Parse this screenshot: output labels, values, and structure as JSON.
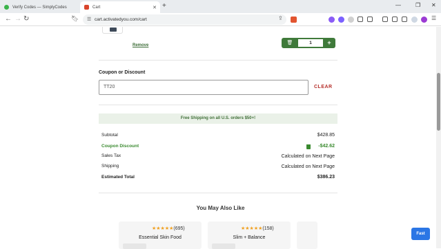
{
  "browser": {
    "tabs": [
      {
        "title": "Verify Codes — SimplyCodes",
        "active": false,
        "favicon_color": "#3bb34a"
      },
      {
        "title": "Cart",
        "active": true,
        "favicon_color": "#d9452c"
      }
    ],
    "new_tab_icon": "plus-icon",
    "url": "cart.activatedyou.com/cart"
  },
  "cart_item": {
    "remove_label": "Remove",
    "quantity": "1"
  },
  "coupon": {
    "title": "Coupon or Discount",
    "value": "TT20",
    "clear_label": "CLEAR"
  },
  "shipping_banner": "Free Shipping on all U.S. orders $50+!",
  "summary": {
    "subtotal_label": "Subtotal",
    "subtotal_value": "$428.85",
    "discount_label": "Coupon Discount",
    "discount_value": "-$42.62",
    "tax_label": "Sales Tax",
    "tax_value": "Calculated on Next Page",
    "shipping_label": "Shipping",
    "shipping_value": "Calculated on Next Page",
    "total_label": "Estimated Total",
    "total_value": "$386.23"
  },
  "also_like": {
    "title": "You May Also Like",
    "products": [
      {
        "stars": "★★★★★",
        "count": "(695)",
        "name": "Essential Skin Food"
      },
      {
        "stars": "★★★★★",
        "count": "(158)",
        "name": "Slim + Balance"
      }
    ]
  },
  "fast_button": "Fast",
  "colors": {
    "brand_green": "#3f7a3a",
    "discount_green": "#3a8a2f",
    "clear_red": "#b6302b",
    "fast_blue": "#2b76e5"
  }
}
